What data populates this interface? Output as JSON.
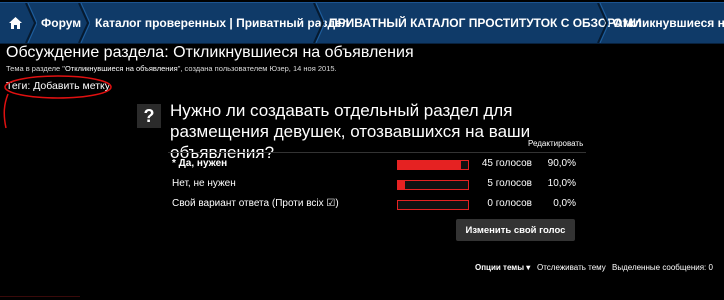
{
  "breadcrumb": {
    "items": [
      {
        "label": "Форум"
      },
      {
        "label": "Каталог проверенных | Приватный раздел"
      },
      {
        "label": "ПРИВАТНЫЙ КАТАЛОГ ПРОСТИТУТОК С ОБЗОРАМИ"
      },
      {
        "label": "Откликнувшиеся на"
      }
    ]
  },
  "thread": {
    "title": "Обсуждение раздела: Откликнувшиеся на объявления",
    "meta_prefix": "Тема в разделе \"",
    "meta_section": "Откликнувшиеся на объявления",
    "meta_middle": "\", создана пользователем ",
    "meta_author": "Юзер",
    "meta_date": ", 14 ноя 2015."
  },
  "tags": {
    "label": "Теги:",
    "add_label": "Добавить метку"
  },
  "poll": {
    "icon_glyph": "?",
    "question": "Нужно ли создавать отдельный раздел для размещения девушек, отозвавшихся на ваши объявления?",
    "edit_label": "Редактировать",
    "options": [
      {
        "label": "* Да, нужен",
        "votes": "45 голосов",
        "percent": "90,0%",
        "fraction": 0.9,
        "selected": true
      },
      {
        "label": "Нет, не нужен",
        "votes": "5 голосов",
        "percent": "10,0%",
        "fraction": 0.1,
        "selected": false
      },
      {
        "label": "Свой вариант ответа (Проти всiх ☑)",
        "votes": "0 голосов",
        "percent": "0,0%",
        "fraction": 0.0,
        "selected": false
      }
    ],
    "change_vote_label": "Изменить свой голос"
  },
  "footer": {
    "thread_options": "Опции темы ▾",
    "watch_thread": "Отслеживать тему",
    "select_messages": "Выделенные сообщения: 0"
  },
  "colors": {
    "breadcrumb_bg": "#0f3a68",
    "bar_red": "#e52222",
    "circle_red": "#e01010"
  }
}
